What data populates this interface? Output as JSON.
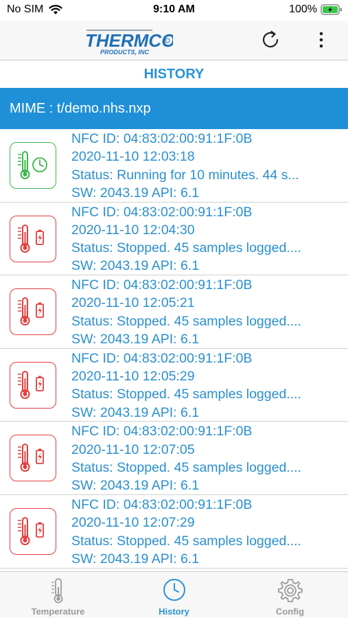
{
  "status_bar": {
    "carrier": "No SIM",
    "time": "9:10 AM",
    "battery": "100%"
  },
  "header": {
    "logo_name": "THERMCO",
    "logo_subtitle": "PRODUCTS, INC",
    "refresh_icon": "refresh-icon",
    "more_icon": "more-vertical-icon"
  },
  "page_title": "HISTORY",
  "mime": "MIME : t/demo.nhs.nxp",
  "colors": {
    "accent": "#2a93d5",
    "mime_bar": "#1f8fd8",
    "running": "#3ab54a",
    "stopped": "#e23c3c"
  },
  "history": [
    {
      "nfc_id": "NFC ID: 04:83:02:00:91:1F:0B",
      "datetime": "2020-11-10 12:03:18",
      "status": "Status: Running for  10 minutes.    44 s...",
      "sw": "SW: 2043.19 API: 6.1",
      "icon": "thermometer-clock-icon",
      "state": "running"
    },
    {
      "nfc_id": "NFC ID: 04:83:02:00:91:1F:0B",
      "datetime": "2020-11-10 12:04:30",
      "status": "Status: Stopped.    45 samples logged....",
      "sw": "SW: 2043.19 API: 6.1",
      "icon": "thermometer-battery-icon",
      "state": "stopped"
    },
    {
      "nfc_id": "NFC ID: 04:83:02:00:91:1F:0B",
      "datetime": "2020-11-10 12:05:21",
      "status": "Status: Stopped.    45 samples logged....",
      "sw": "SW: 2043.19 API: 6.1",
      "icon": "thermometer-battery-icon",
      "state": "stopped"
    },
    {
      "nfc_id": "NFC ID: 04:83:02:00:91:1F:0B",
      "datetime": "2020-11-10 12:05:29",
      "status": "Status: Stopped.    45 samples logged....",
      "sw": "SW: 2043.19 API: 6.1",
      "icon": "thermometer-battery-icon",
      "state": "stopped"
    },
    {
      "nfc_id": "NFC ID: 04:83:02:00:91:1F:0B",
      "datetime": "2020-11-10 12:07:05",
      "status": "Status: Stopped.    45 samples logged....",
      "sw": "SW: 2043.19 API: 6.1",
      "icon": "thermometer-battery-icon",
      "state": "stopped"
    },
    {
      "nfc_id": "NFC ID: 04:83:02:00:91:1F:0B",
      "datetime": "2020-11-10 12:07:29",
      "status": "Status: Stopped.    45 samples logged....",
      "sw": "SW: 2043.19 API: 6.1",
      "icon": "thermometer-battery-icon",
      "state": "stopped"
    }
  ],
  "tabs": [
    {
      "label": "Temperature",
      "icon": "thermometer-icon",
      "active": false
    },
    {
      "label": "History",
      "icon": "clock-icon",
      "active": true
    },
    {
      "label": "Config",
      "icon": "gear-icon",
      "active": false
    }
  ]
}
